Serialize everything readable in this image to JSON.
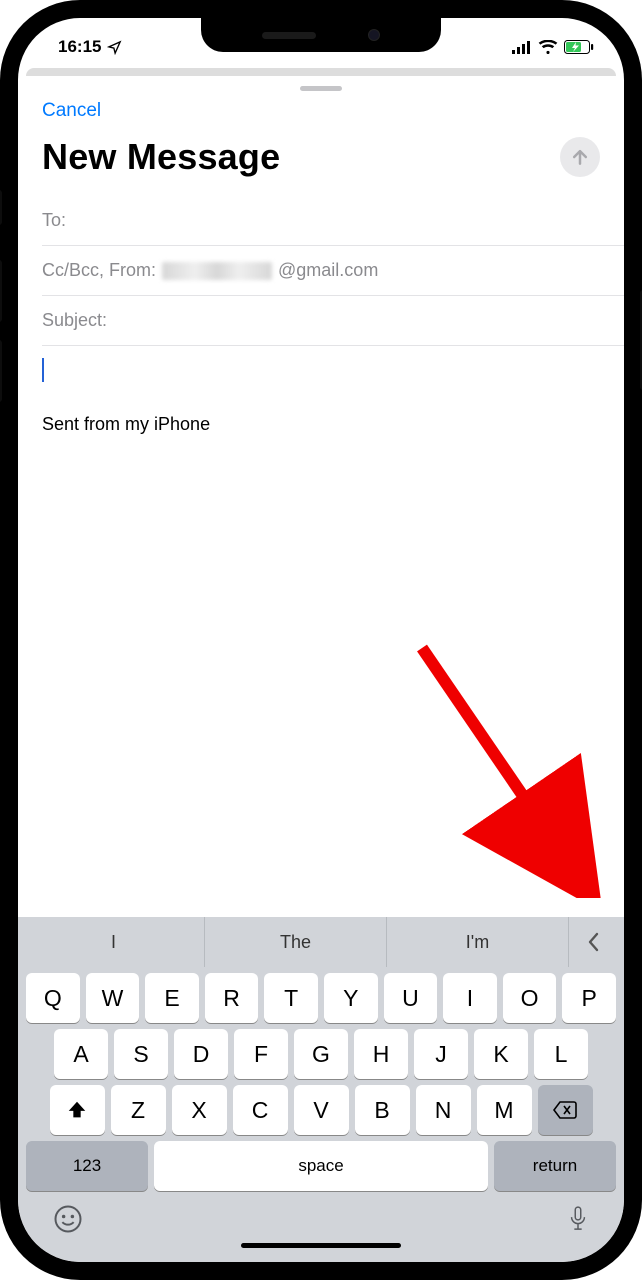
{
  "status": {
    "time": "16:15"
  },
  "sheet": {
    "cancel": "Cancel",
    "title": "New Message",
    "to_label": "To:",
    "ccbcc_label": "Cc/Bcc, From:",
    "from_suffix": "@gmail.com",
    "subject_label": "Subject:",
    "signature": "Sent from my iPhone"
  },
  "predictions": [
    "I",
    "The",
    "I'm"
  ],
  "keyboard": {
    "row1": [
      "Q",
      "W",
      "E",
      "R",
      "T",
      "Y",
      "U",
      "I",
      "O",
      "P"
    ],
    "row2": [
      "A",
      "S",
      "D",
      "F",
      "G",
      "H",
      "J",
      "K",
      "L"
    ],
    "row3": [
      "Z",
      "X",
      "C",
      "V",
      "B",
      "N",
      "M"
    ],
    "numeric": "123",
    "space": "space",
    "ret": "return"
  }
}
